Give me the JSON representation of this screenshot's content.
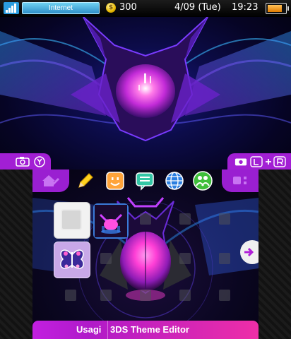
{
  "status_bar": {
    "connection_label": "Internet",
    "coin_glyph": "$",
    "coin_count": "300",
    "date": "4/09 (Tue)",
    "time": "19:23",
    "battery_level": 0.85
  },
  "top_tabs": {
    "left_icons": [
      "camera-icon",
      "y-button-icon"
    ],
    "right_icons": [
      "camera-icon",
      "l-button-icon",
      "r-button-icon"
    ]
  },
  "toolbar": {
    "items": [
      "home-settings-icon",
      "pencil-icon",
      "smiley-icon",
      "chat-icon",
      "globe-icon",
      "friends-icon",
      "grid-view-icon"
    ]
  },
  "banner": {
    "left_text": "Usagi",
    "right_text": "3DS Theme Editor"
  },
  "colors": {
    "accent_purple": "#a21fd4",
    "banner_pink": "#ee2ea7",
    "glow_magenta": "#ff3fd6",
    "glow_blue": "#2a6bff"
  }
}
